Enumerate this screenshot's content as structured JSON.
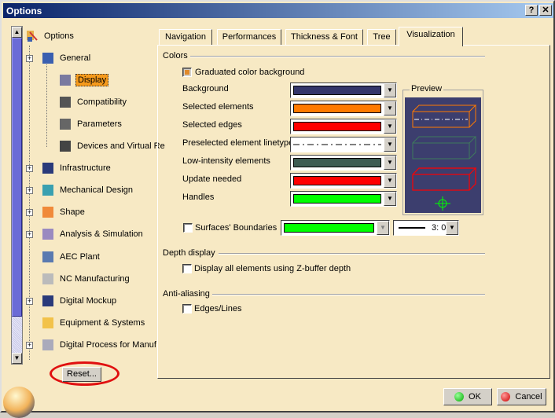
{
  "window": {
    "title": "Options",
    "help_label": "?",
    "close_label": "✕"
  },
  "tree": {
    "root": "Options",
    "items": [
      {
        "label": "General",
        "icon": "general-icon"
      },
      {
        "label": "Display",
        "icon": "display-icon",
        "selected": true
      },
      {
        "label": "Compatibility",
        "icon": "compatibility-icon"
      },
      {
        "label": "Parameters",
        "icon": "parameters-icon"
      },
      {
        "label": "Devices and Virtual Re",
        "icon": "devices-icon"
      },
      {
        "label": "Infrastructure",
        "icon": "infrastructure-icon"
      },
      {
        "label": "Mechanical Design",
        "icon": "mechanical-design-icon"
      },
      {
        "label": "Shape",
        "icon": "shape-icon"
      },
      {
        "label": "Analysis & Simulation",
        "icon": "analysis-icon"
      },
      {
        "label": "AEC Plant",
        "icon": "aec-plant-icon"
      },
      {
        "label": "NC Manufacturing",
        "icon": "nc-manufacturing-icon"
      },
      {
        "label": "Digital Mockup",
        "icon": "digital-mockup-icon"
      },
      {
        "label": "Equipment & Systems",
        "icon": "equipment-icon"
      },
      {
        "label": "Digital Process for Manuf",
        "icon": "digital-process-icon"
      }
    ],
    "reset_label": "Reset..."
  },
  "tabs": [
    "Navigation",
    "Performances",
    "Thickness & Font",
    "Tree",
    "Visualization"
  ],
  "active_tab": "Visualization",
  "colors": {
    "section_label": "Colors",
    "graduated_label": "Graduated color background",
    "graduated_checked": true,
    "rows": [
      {
        "label": "Background",
        "color": "#34366a"
      },
      {
        "label": "Selected elements",
        "color": "#ff7a00"
      },
      {
        "label": "Selected edges",
        "color": "#ff0000"
      },
      {
        "label": "Preselected element linetype",
        "color": "#ffffff",
        "linetype": "dash-dot"
      },
      {
        "label": "Low-intensity elements",
        "color": "#3e5c52"
      },
      {
        "label": "Update needed",
        "color": "#ff0000"
      },
      {
        "label": "Handles",
        "color": "#00ff00"
      }
    ],
    "preview_label": "Preview",
    "surfaces_label": "Surfaces' Boundaries",
    "surfaces_checked": false,
    "surfaces_color": "#00ff00",
    "surfaces_thickness": "3: 0"
  },
  "depth": {
    "section_label": "Depth display",
    "zbuffer_label": "Display all elements using Z-buffer depth",
    "zbuffer_checked": false
  },
  "antialias": {
    "section_label": "Anti-aliasing",
    "edges_label": "Edges/Lines",
    "edges_checked": false
  },
  "footer": {
    "ok_label": "OK",
    "cancel_label": "Cancel"
  }
}
